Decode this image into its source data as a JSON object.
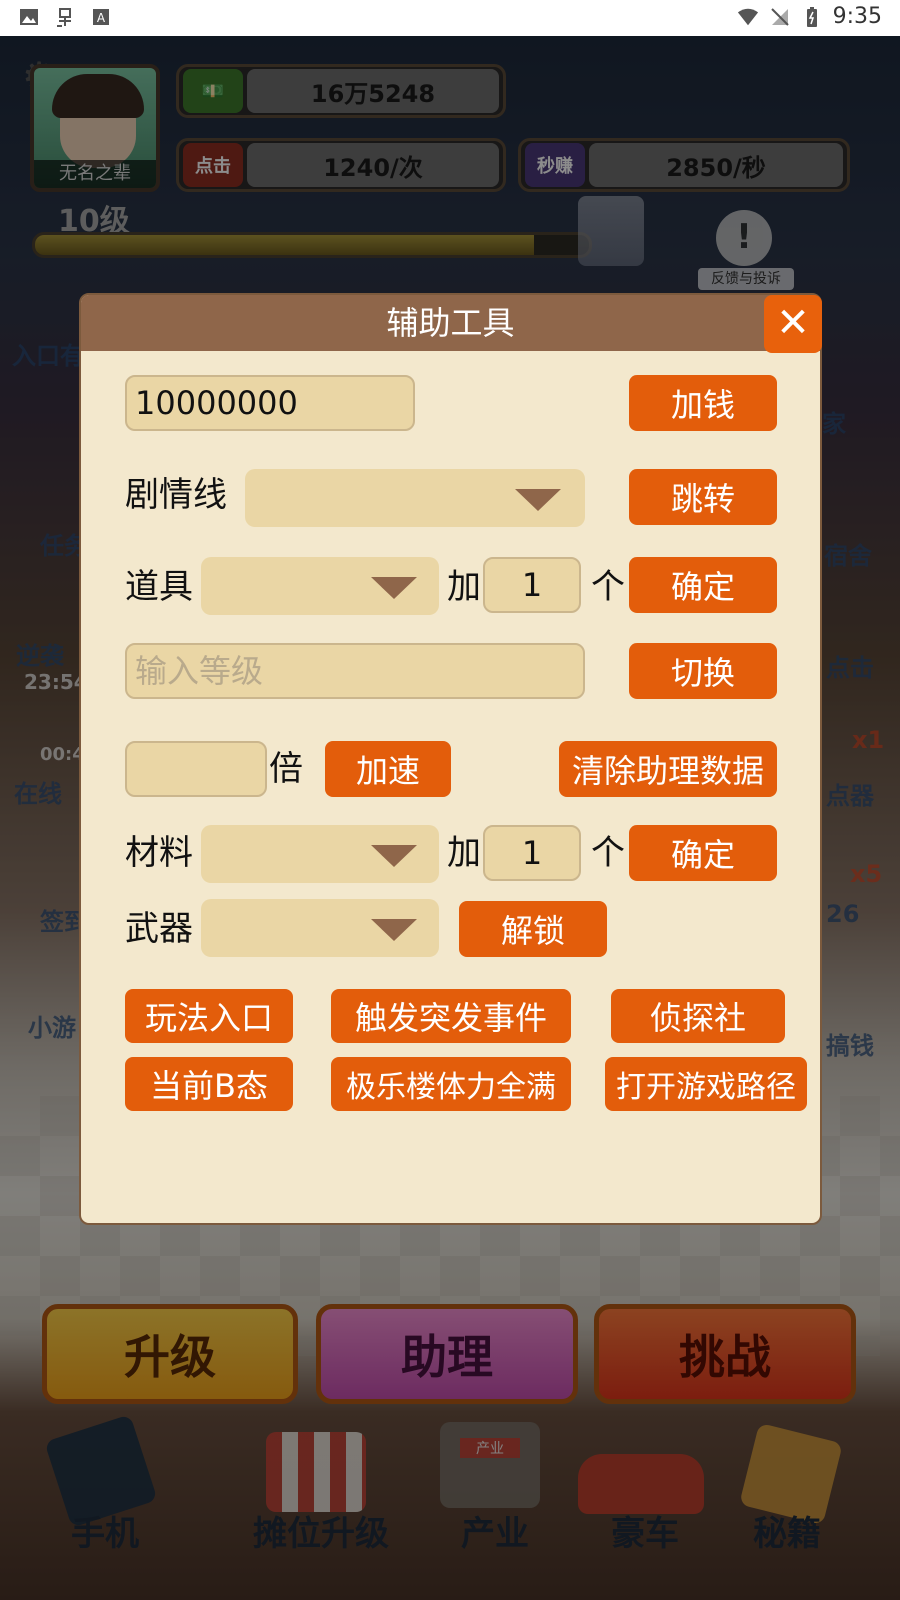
{
  "status_bar": {
    "time": "9:35"
  },
  "hud": {
    "player_name": "无名之辈",
    "money": "16万5248",
    "click_tag": "点击",
    "click_value": "1240/次",
    "earn_tag": "秒赚",
    "earn_value": "2850/秒",
    "level": "10级",
    "level_progress": 0.9,
    "feedback_label": "反馈与投诉"
  },
  "side_labels": {
    "left": [
      "入口有",
      "任务",
      "逆袭",
      "23:54",
      "00:4",
      "在线",
      "签到",
      "小游"
    ],
    "right": [
      "家",
      "宿舍",
      "点击",
      "x1",
      "点器",
      "x5",
      "26",
      "搞钱"
    ]
  },
  "bottom_buttons": {
    "upgrade": "升级",
    "assistant": "助理",
    "challenge": "挑战"
  },
  "nav": {
    "phone": "手机",
    "stall": "摊位升级",
    "industry": "产业",
    "car": "豪车",
    "secrets": "秘籍",
    "industry_sign": "产业"
  },
  "dialog": {
    "title": "辅助工具",
    "close_symbol": "✕",
    "money_input_value": "10000000",
    "add_money_button": "加钱",
    "storyline_label": "剧情线",
    "storyline_selected": "",
    "jump_button": "跳转",
    "item_label": "道具",
    "item_selected": "",
    "add_word": "加",
    "item_qty": "1",
    "unit_word": "个",
    "confirm_button": "确定",
    "level_placeholder": "输入等级",
    "switch_button": "切换",
    "speed_value": "",
    "times_word": "倍",
    "speed_button": "加速",
    "clear_button": "清除助理数据",
    "material_label": "材料",
    "material_selected": "",
    "material_qty": "1",
    "weapon_label": "武器",
    "weapon_selected": "",
    "unlock_button": "解锁",
    "btn_gameplay": "玩法入口",
    "btn_event": "触发突发事件",
    "btn_detective": "侦探社",
    "btn_b_state": "当前B态",
    "btn_stamina": "极乐楼体力全满",
    "btn_path": "打开游戏路径"
  }
}
